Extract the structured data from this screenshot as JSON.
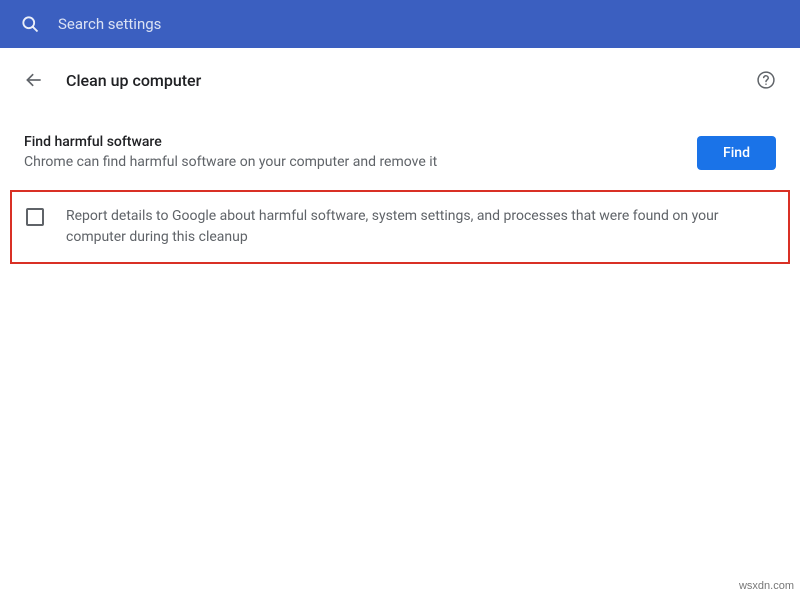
{
  "search": {
    "placeholder": "Search settings"
  },
  "header": {
    "title": "Clean up computer"
  },
  "section": {
    "title": "Find harmful software",
    "description": "Chrome can find harmful software on your computer and remove it",
    "button_label": "Find"
  },
  "report": {
    "label": "Report details to Google about harmful software, system settings, and processes that were found on your computer during this cleanup"
  },
  "watermark": "wsxdn.com"
}
